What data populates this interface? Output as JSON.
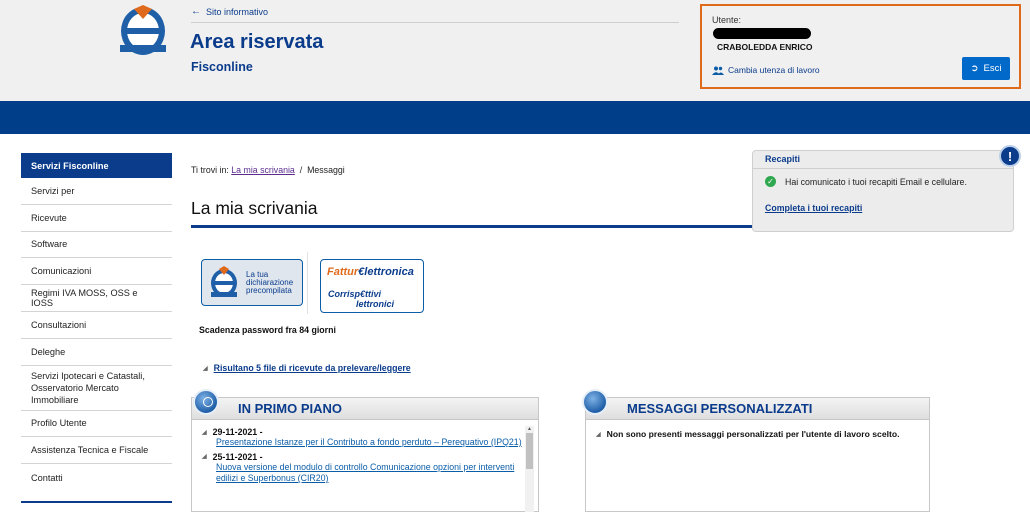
{
  "header": {
    "back_link": "Sito informativo",
    "title": "Area riservata",
    "subtitle": "Fisconline"
  },
  "user": {
    "label": "Utente:",
    "name": "CRABOLEDDA ENRICO",
    "change_link": "Cambia utenza di lavoro",
    "exit_label": "Esci"
  },
  "sidebar": {
    "items": [
      {
        "label": "Servizi Fisconline"
      },
      {
        "label": "Servizi per"
      },
      {
        "label": "Ricevute"
      },
      {
        "label": "Software"
      },
      {
        "label": "Comunicazioni"
      },
      {
        "label": "Regimi IVA MOSS, OSS e IOSS"
      },
      {
        "label": "Consultazioni"
      },
      {
        "label": "Deleghe"
      },
      {
        "label": "Servizi Ipotecari e Catastali, Osservatorio Mercato Immobiliare"
      },
      {
        "label": "Profilo Utente"
      },
      {
        "label": "Assistenza Tecnica e Fiscale"
      },
      {
        "label": "Contatti"
      }
    ]
  },
  "breadcrumb": {
    "prefix": "Ti trovi in:",
    "link": "La mia scrivania",
    "separator": "/",
    "current": "Messaggi"
  },
  "main": {
    "title": "La mia scrivania",
    "badge1": {
      "line1": "La tua",
      "line2": "dichiarazione",
      "line3": "precompilata"
    },
    "badge2": {
      "line1a": "Fattur",
      "line1b": "lettronica",
      "line2a": "Corrisp",
      "line2b": "ttivi",
      "line3": "lettronici"
    },
    "password_note": "Scadenza password fra 84 giorni",
    "receipts_link": "Risultano 5 file di ricevute da prelevare/leggere"
  },
  "recapiti": {
    "title": "Recapiti",
    "message": "Hai comunicato i tuoi recapiti Email e cellulare.",
    "link": "Completa i tuoi recapiti"
  },
  "primo_piano": {
    "title": "IN PRIMO PIANO",
    "items": [
      {
        "date": "29-11-2021 -",
        "title": "Presentazione Istanze per il Contributo a fondo perduto – Perequativo (IPQ21)"
      },
      {
        "date": "25-11-2021 -",
        "title": "Nuova versione del modulo di controllo Comunicazione opzioni per interventi edilizi e Superbonus (CIR20)"
      }
    ]
  },
  "messaggi": {
    "title": "MESSAGGI PERSONALIZZATI",
    "empty": "Non sono presenti messaggi personalizzati per l'utente di lavoro scelto."
  },
  "colors": {
    "brand": "#0b3c8c",
    "band": "#003e8a",
    "highlight": "#e06a1c",
    "exit_button": "#0069c9"
  }
}
